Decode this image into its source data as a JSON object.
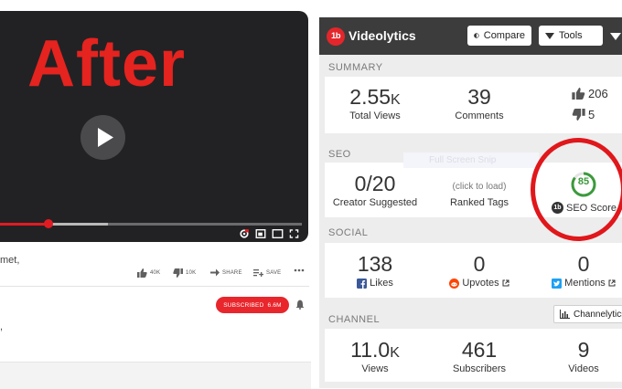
{
  "video": {
    "overlay_text": "After",
    "progress_played": 0.19,
    "progress_buffered": 0.38
  },
  "below_video": {
    "channel_fragment": "met,",
    "meta_fragment": ",",
    "like_count": "40K",
    "dislike_count": "10K",
    "share_label": "SHARE",
    "save_label": "SAVE",
    "subscribe_label": "SUBSCRIBED",
    "subscriber_count": "6.6M"
  },
  "extension": {
    "brand_badge": "1b",
    "brand_name": "Videolytics",
    "compare_label": "Compare",
    "tools_label": "Tools",
    "accent_color": "#e3262b",
    "summary": {
      "section": "SUMMARY",
      "views_value": "2.55",
      "views_unit": "K",
      "views_label": "Total Views",
      "comments_value": "39",
      "comments_label": "Comments",
      "likes": "206",
      "dislikes": "5"
    },
    "seo": {
      "section": "SEO",
      "suggested_value": "0/20",
      "suggested_label": "Creator Suggested",
      "tags_hint": "(click to load)",
      "tags_label": "Ranked Tags",
      "score_value": "85",
      "score_fraction": 0.85,
      "score_label": "SEO Score",
      "score_badge": "1b",
      "score_color": "#3c9a3c"
    },
    "social": {
      "section": "SOCIAL",
      "likes_value": "138",
      "likes_label": "Likes",
      "upvotes_value": "0",
      "upvotes_label": "Upvotes",
      "mentions_value": "0",
      "mentions_label": "Mentions"
    },
    "channel": {
      "section": "CHANNEL",
      "channelytics_label": "Channelytics",
      "views_value": "11.0",
      "views_unit": "K",
      "views_label": "Views",
      "subscribers_value": "461",
      "subscribers_label": "Subscribers",
      "videos_value": "9",
      "videos_label": "Videos"
    },
    "ghost_overlay": "Full Screen Snip"
  }
}
